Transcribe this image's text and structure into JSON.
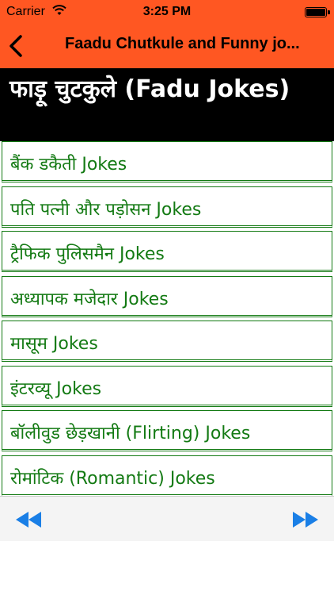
{
  "status_bar": {
    "carrier": "Carrier",
    "time": "3:25 PM",
    "wifi_icon": "wifi-icon",
    "battery_icon": "battery-icon"
  },
  "nav": {
    "title": "Faadu Chutkule and Funny jo...",
    "back_icon": "chevron-left-icon"
  },
  "header": {
    "title": "फाड़ू चुटकुले (Fadu Jokes)"
  },
  "list": {
    "items": [
      {
        "label": "बैंक डकैती Jokes"
      },
      {
        "label": "पति पत्नी और पड़ोसन Jokes"
      },
      {
        "label": "ट्रैफिक पुलिसमैन Jokes"
      },
      {
        "label": "अध्यापक मजेदार Jokes"
      },
      {
        "label": "मासूम Jokes"
      },
      {
        "label": "इंटरव्यू Jokes"
      },
      {
        "label": "बॉलीवुड छेड़खानी (Flirting) Jokes"
      },
      {
        "label": "रोमांटिक (Romantic) Jokes"
      }
    ]
  },
  "toolbar": {
    "prev_icon": "rewind-icon",
    "next_icon": "fast-forward-icon"
  },
  "colors": {
    "bar": "#ff5722",
    "list_text": "#137a13",
    "list_border": "#137a13",
    "toolbar_icon": "#1a7fe6"
  }
}
